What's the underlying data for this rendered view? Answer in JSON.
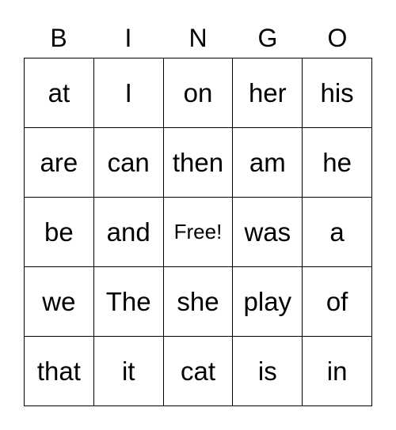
{
  "header": [
    "B",
    "I",
    "N",
    "G",
    "O"
  ],
  "cells": [
    [
      "at",
      "I",
      "on",
      "her",
      "his"
    ],
    [
      "are",
      "can",
      "then",
      "am",
      "he"
    ],
    [
      "be",
      "and",
      "Free!",
      "was",
      "a"
    ],
    [
      "we",
      "The",
      "she",
      "play",
      "of"
    ],
    [
      "that",
      "it",
      "cat",
      "is",
      "in"
    ]
  ]
}
